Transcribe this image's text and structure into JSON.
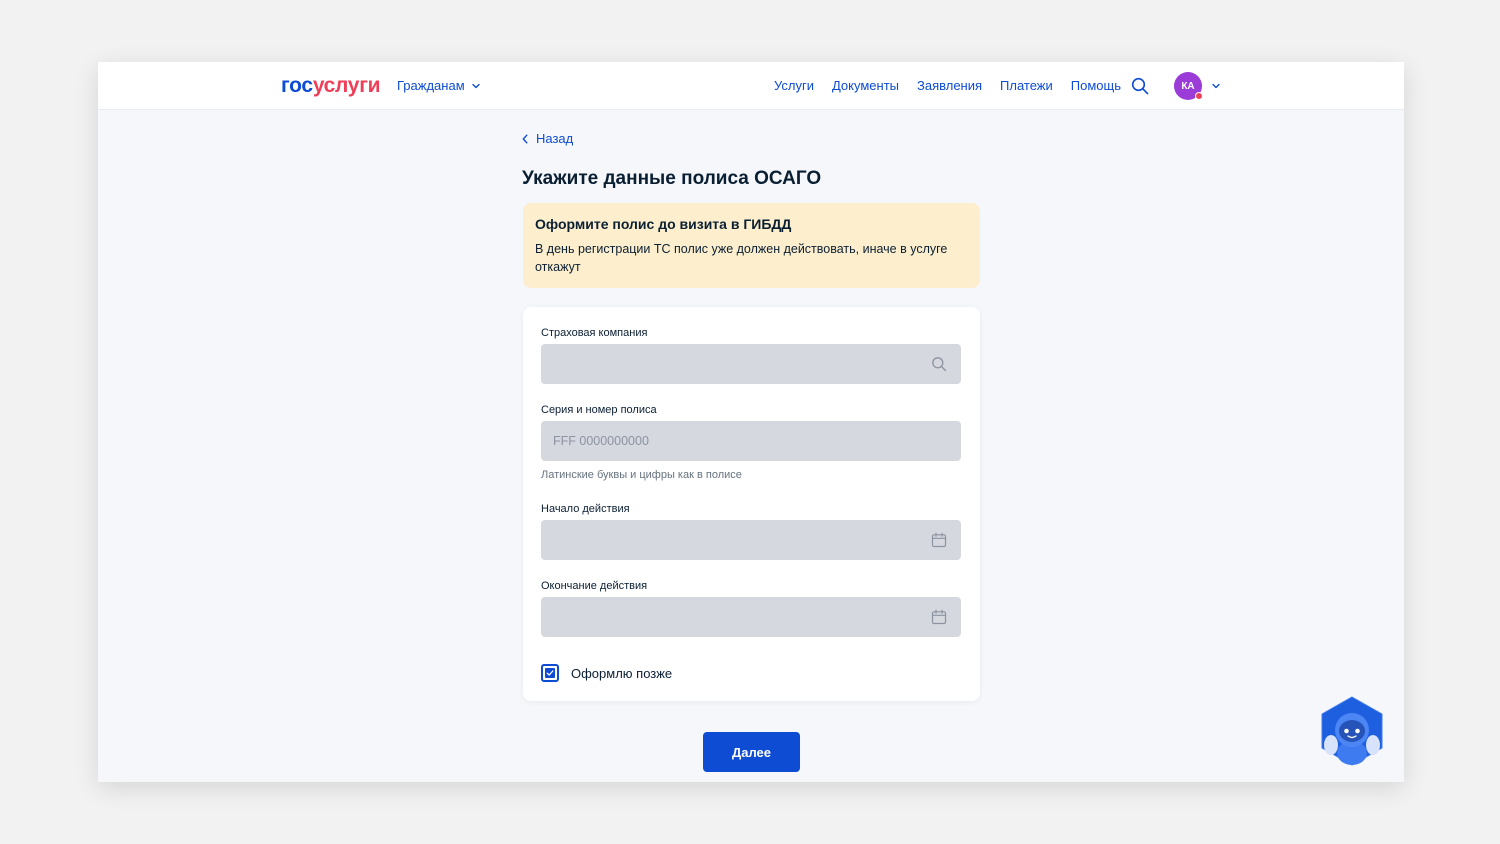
{
  "header": {
    "logo_part1": "гос",
    "logo_part2": "услуги",
    "audience_label": "Гражданам",
    "nav": [
      "Услуги",
      "Документы",
      "Заявления",
      "Платежи",
      "Помощь"
    ],
    "avatar_initials": "КА",
    "icons": {
      "search": "search-icon",
      "audience_chevron": "chevron-down-icon",
      "user_chevron": "chevron-down-icon"
    }
  },
  "back_label": "Назад",
  "page_title": "Укажите данные полиса ОСАГО",
  "notice": {
    "title": "Оформите полис до визита в ГИБДД",
    "text": "В день регистрации ТС полис уже должен действовать, иначе в услуге откажут"
  },
  "form": {
    "insurer_label": "Страховая компания",
    "insurer_value": "",
    "policy_label": "Серия и номер полиса",
    "policy_placeholder": "FFF 0000000000",
    "policy_hint": "Латинские буквы и цифры как в полисе",
    "start_label": "Начало действия",
    "end_label": "Окончание действия",
    "later_label": "Оформлю позже",
    "later_checked": true
  },
  "next_label": "Далее",
  "colors": {
    "accent": "#0d4cd3",
    "logo_red": "#ee3f58",
    "notice_bg": "#fdefcd",
    "field_bg": "#d5d8df",
    "avatar_bg": "#9b3cd8"
  }
}
